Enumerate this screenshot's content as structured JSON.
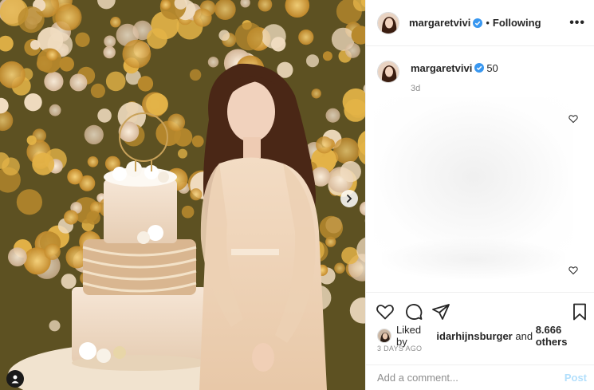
{
  "header": {
    "username": "margaretvivi",
    "separator": "•",
    "follow_state": "Following",
    "more": "•••"
  },
  "caption": {
    "username": "margaretvivi",
    "text": "50",
    "age": "3d"
  },
  "likes": {
    "prefix": "Liked by",
    "liker": "idarhijnsburger",
    "conjunction": "and",
    "others": "8.666 others"
  },
  "date": "3 DAYS AGO",
  "comment_box": {
    "placeholder": "Add a comment...",
    "post_label": "Post"
  },
  "colors": {
    "verified": "#3897f0",
    "post_disabled": "#b2dffc",
    "muted": "#8e8e8e"
  },
  "icons": {
    "like": "heart-icon",
    "comment": "comment-icon",
    "share": "share-icon",
    "save": "bookmark-icon",
    "next": "chevron-right-icon",
    "tags": "user-tag-icon"
  }
}
